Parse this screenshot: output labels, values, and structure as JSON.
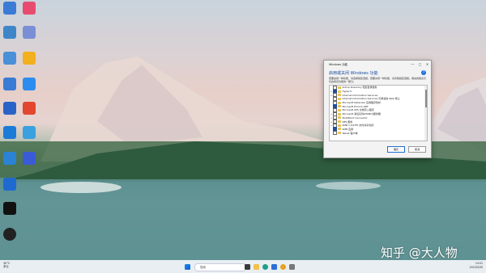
{
  "desktop_icons": [
    {
      "label": "",
      "color": "#3a7bd5"
    },
    {
      "label": "",
      "color": "#e74c6f"
    },
    {
      "label": "",
      "color": "#3f86c8"
    },
    {
      "label": "",
      "color": "#7a8fd6"
    },
    {
      "label": "",
      "color": "#4a90d9"
    },
    {
      "label": "",
      "color": "#f2b01e"
    },
    {
      "label": "",
      "color": "#3a7bd5"
    },
    {
      "label": "",
      "color": "#2d8cf0"
    },
    {
      "label": "",
      "color": "#2a63c7"
    },
    {
      "label": "",
      "color": "#e2462f"
    },
    {
      "label": "",
      "color": "#1c7ad8"
    },
    {
      "label": "",
      "color": "#3aa0e0"
    },
    {
      "label": "",
      "color": "#2b83d6"
    },
    {
      "label": "",
      "color": "#3a5bd8"
    },
    {
      "label": "",
      "color": "#1e6ad0"
    },
    {
      "label": "",
      "color": "#111111"
    },
    {
      "label": "",
      "color": "#222222"
    }
  ],
  "dialog": {
    "title": "Windows 功能",
    "heading": "启用或关闭 Windows 功能",
    "description": "若要启用一种功能，请选择其复选框。若要关闭一种功能，请清除其复选框。填充的框表示仅启用该功能的一部分。",
    "ok_label": "确定",
    "cancel_label": "取消",
    "features": [
      {
        "label": "Active Directory 轻型目录服务",
        "state": "off",
        "expandable": false
      },
      {
        "label": "Hyper-V",
        "state": "on",
        "expandable": true
      },
      {
        "label": "Internet Information Services",
        "state": "off",
        "expandable": true
      },
      {
        "label": "Internet Information Services 可承载的 Web 核心",
        "state": "off",
        "expandable": false
      },
      {
        "label": "Microsoft Defender 应用程序防护",
        "state": "off",
        "expandable": false
      },
      {
        "label": "Microsoft Print to PDF",
        "state": "on",
        "expandable": false
      },
      {
        "label": "Microsoft XPS 文档写入程序",
        "state": "off",
        "expandable": false
      },
      {
        "label": "Microsoft 消息队列(MSMQ)服务器",
        "state": "off",
        "expandable": true
      },
      {
        "label": "MultiPoint Connector",
        "state": "off",
        "expandable": true
      },
      {
        "label": "NFS 服务",
        "state": "off",
        "expandable": true
      },
      {
        "label": "SMB 1.0/CIFS 文件共享支持",
        "state": "off",
        "expandable": true
      },
      {
        "label": "SMB 直通",
        "state": "on",
        "expandable": false
      },
      {
        "label": "Telnet 客户端",
        "state": "off",
        "expandable": false
      }
    ]
  },
  "watermark": "知乎 @大人物",
  "taskbar": {
    "weather_temp": "30°C",
    "weather_desc": "多云",
    "search_placeholder": "搜索",
    "time": "14:51",
    "date": "2023/5/30"
  },
  "colors": {
    "accent": "#1f6fd0",
    "dialog_bg": "#f3f3f3",
    "taskbar_bg": "#e9eef3"
  }
}
